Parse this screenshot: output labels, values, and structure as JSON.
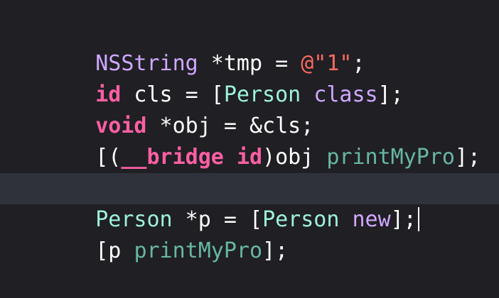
{
  "editor": {
    "colors": {
      "background": "#1f1f24",
      "current_line": "#2f323a",
      "keyword": "#fc5fa3",
      "type": "#d0a8ff",
      "class_name": "#9ef1dd",
      "method": "#67b7a4",
      "string": "#fc6a5d",
      "plain": "#ffffff"
    },
    "lines": [
      {
        "tokens": [
          "NSString",
          " *tmp = ",
          "@\"1\"",
          ";"
        ]
      },
      {
        "tokens": [
          "id",
          " cls = [",
          "Person",
          " ",
          "class",
          "];"
        ]
      },
      {
        "tokens": [
          "void",
          " *obj = &cls;"
        ]
      },
      {
        "tokens": [
          "[(",
          "__bridge",
          " ",
          "id",
          ")obj ",
          "printMyPro",
          "];"
        ]
      },
      {
        "tokens": []
      },
      {
        "tokens": [
          "Person",
          " *p = [",
          "Person",
          " ",
          "new",
          "];"
        ]
      },
      {
        "tokens": [
          "[p ",
          "printMyPro",
          "];"
        ]
      }
    ]
  }
}
